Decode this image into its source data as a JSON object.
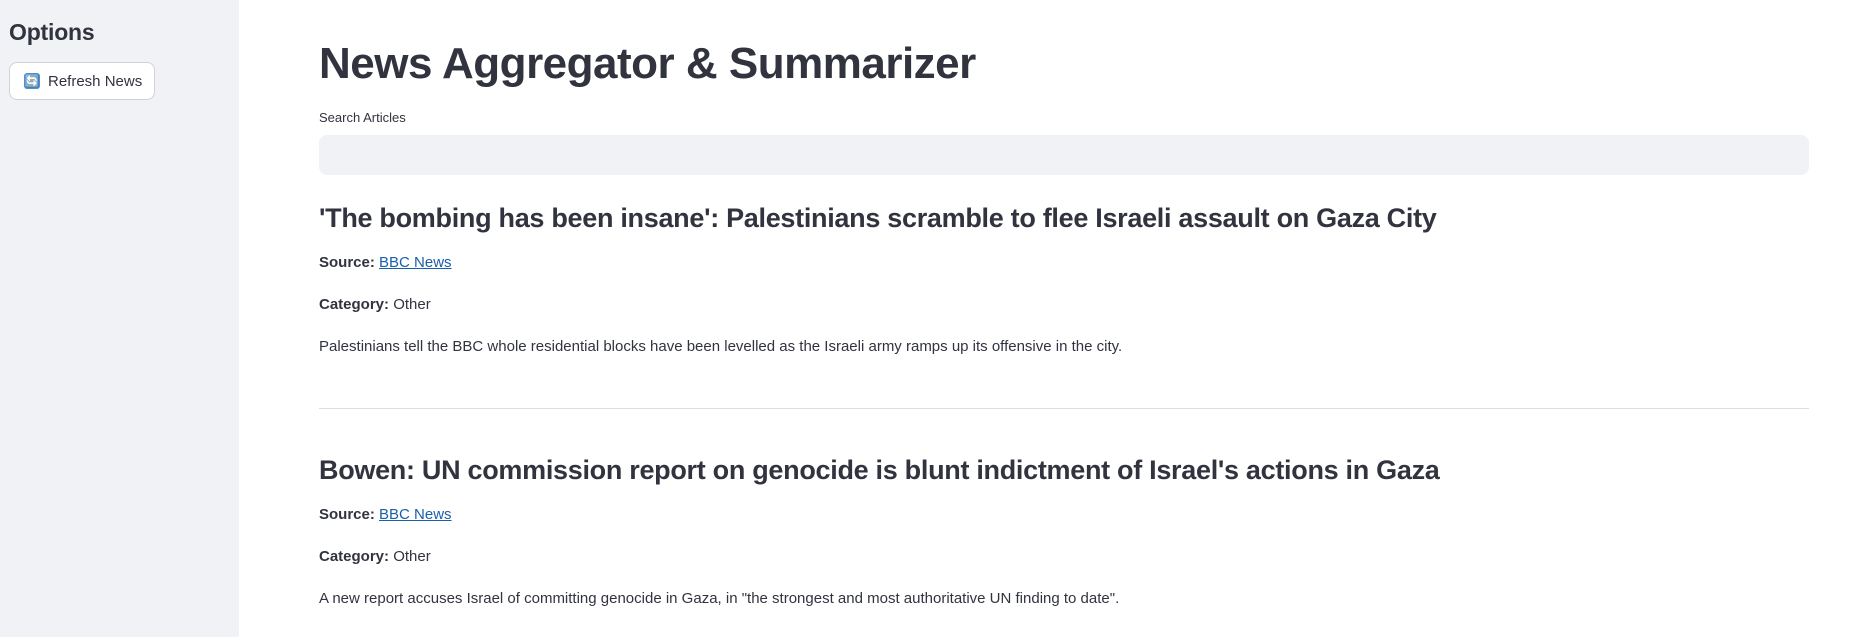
{
  "sidebar": {
    "title": "Options",
    "refresh_button": {
      "icon": "refresh-icon",
      "icon_glyph": "🔄",
      "label": "Refresh News"
    }
  },
  "main": {
    "title": "News Aggregator & Summarizer",
    "search": {
      "label": "Search Articles",
      "value": "",
      "placeholder": ""
    },
    "articles": [
      {
        "title": "'The bombing has been insane': Palestinians scramble to flee Israeli assault on Gaza City",
        "source_key": "Source:",
        "source": "BBC News",
        "category_key": "Category:",
        "category": "Other",
        "summary": "Palestinians tell the BBC whole residential blocks have been levelled as the Israeli army ramps up its offensive in the city."
      },
      {
        "title": "Bowen: UN commission report on genocide is blunt indictment of Israel's actions in Gaza",
        "source_key": "Source:",
        "source": "BBC News",
        "category_key": "Category:",
        "category": "Other",
        "summary": "A new report accuses Israel of committing genocide in Gaza, in \"the strongest and most authoritative UN finding to date\"."
      }
    ]
  },
  "colors": {
    "sidebar_bg": "#f0f2f6",
    "text": "#31333f",
    "link": "#1a5fa8",
    "input_bg": "#f0f2f6",
    "divider": "#dcdde2"
  }
}
